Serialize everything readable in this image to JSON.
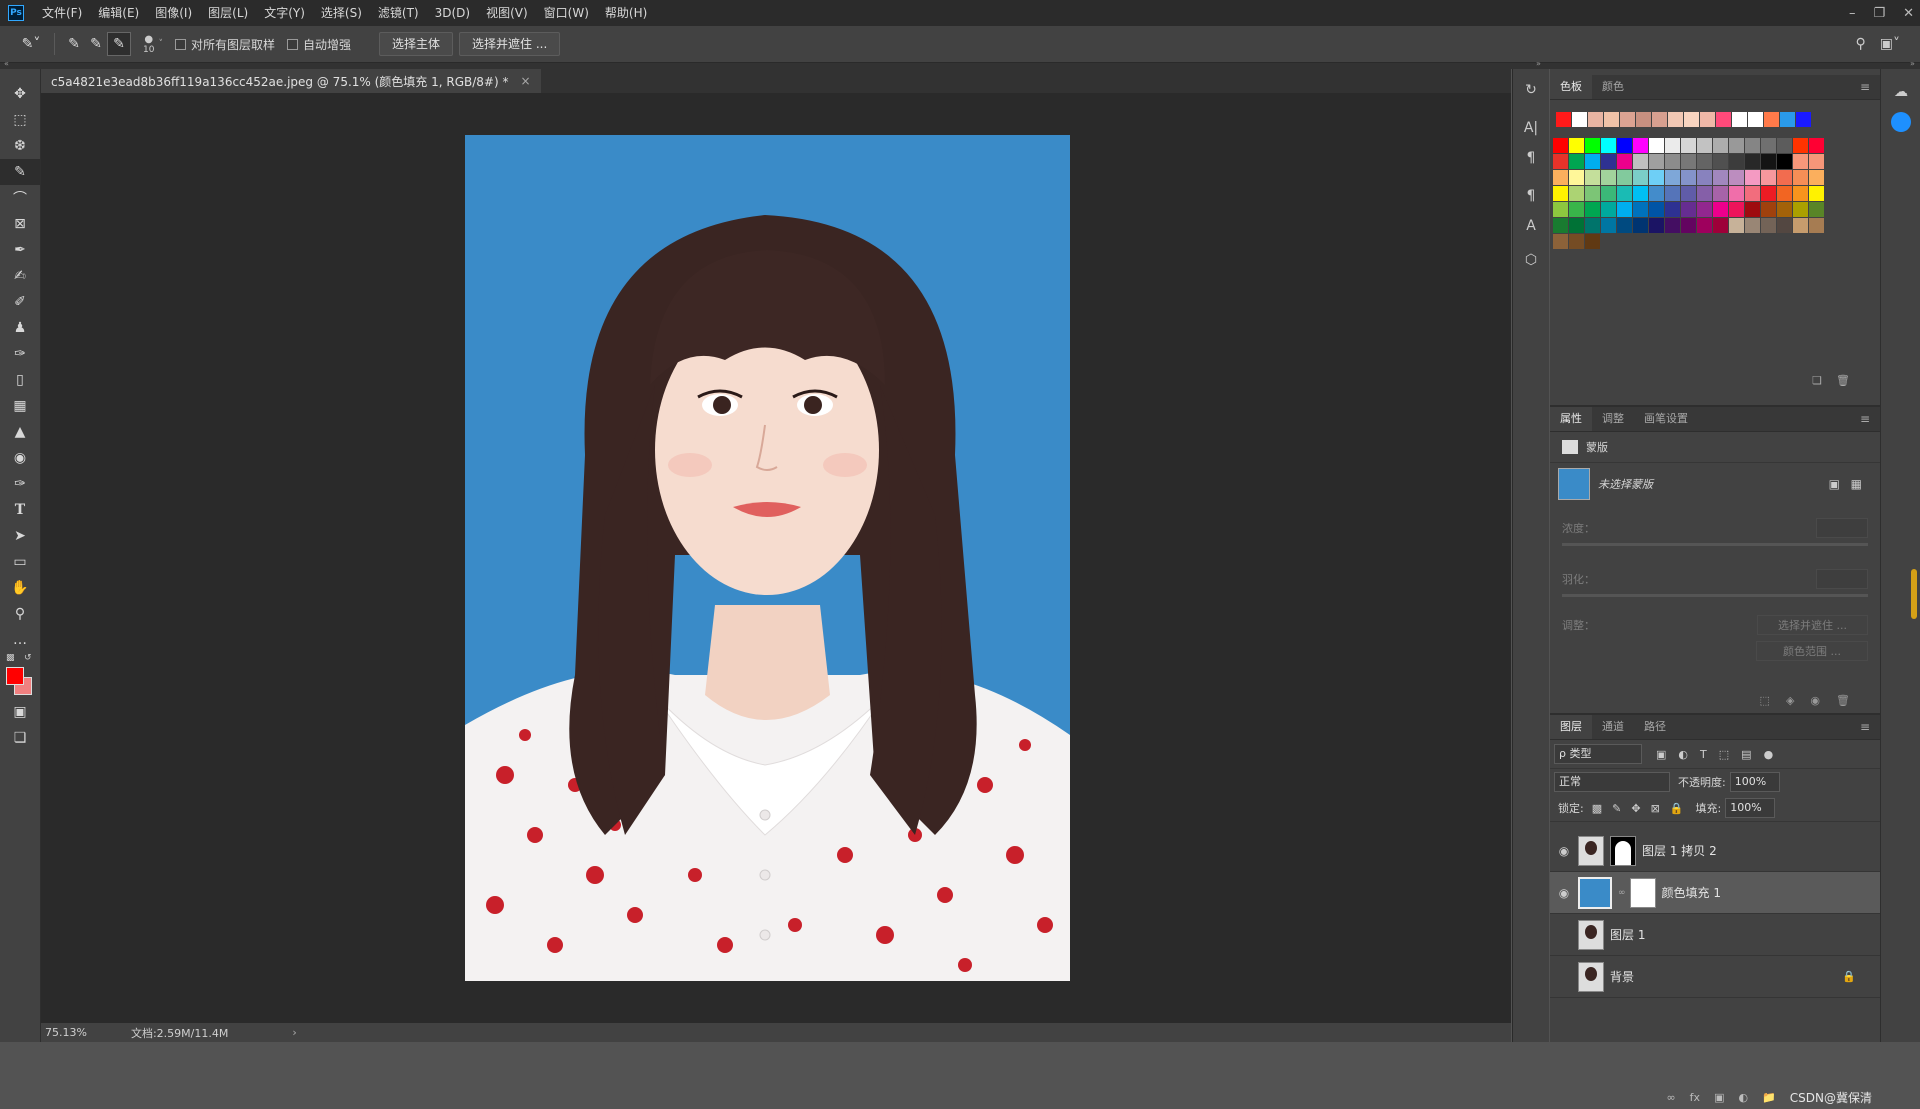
{
  "menu": {
    "logo": "Ps",
    "items": [
      "文件(F)",
      "编辑(E)",
      "图像(I)",
      "图层(L)",
      "文字(Y)",
      "选择(S)",
      "滤镜(T)",
      "3D(D)",
      "视图(V)",
      "窗口(W)",
      "帮助(H)"
    ]
  },
  "options": {
    "brush_size": "10",
    "sample_all_layers": "对所有图层取样",
    "auto_enhance": "自动增强",
    "select_subject": "选择主体",
    "select_and_mask": "选择并遮住 ..."
  },
  "document": {
    "tab_title": "c5a4821e3ead8b36ff119a136cc452ae.jpeg @ 75.1% (颜色填充 1, RGB/8#) *",
    "zoom": "75.13%",
    "doc_size": "文档:2.59M/11.4M"
  },
  "swatches_panel": {
    "tabs": [
      "色板",
      "颜色"
    ],
    "recent": [
      "#ff1a1a",
      "#ffffff",
      "#e8b4a2",
      "#f0c2a8",
      "#dca392",
      "#c89080",
      "#d8a090",
      "#f2c8b4",
      "#f8d4c0",
      "#f0b8a8",
      "#ff4a7a",
      "#ffffff",
      "#ffffff",
      "#ff7a4a",
      "#2a9aea",
      "#1a1aff"
    ],
    "grid": [
      [
        "#ff0000",
        "#ffff00",
        "#00ff00",
        "#00ffff",
        "#0000ff",
        "#ff00ff",
        "#ffffff",
        "#ebebeb",
        "#d6d6d6",
        "#c2c2c2",
        "#adadad",
        "#999999",
        "#858585",
        "#707070",
        "#5c5c5c",
        "#ff3300",
        "#ff0033"
      ],
      [
        "#e6332a",
        "#00a651",
        "#00aeef",
        "#2e3192",
        "#ec008c",
        "#c0c0c0",
        "#a0a0a0",
        "#8c8c8c",
        "#787878",
        "#646464",
        "#505050",
        "#3c3c3c",
        "#282828",
        "#141414",
        "#000000",
        "#f7977a",
        "#f69679"
      ],
      [
        "#fbaf5d",
        "#fff799",
        "#c4df9b",
        "#a2d39c",
        "#82ca9d",
        "#7bcdc8",
        "#6ecff6",
        "#7ea7d8",
        "#8493ca",
        "#8882be",
        "#a187be",
        "#bc8dbf",
        "#f49ac2",
        "#f6989d",
        "#f26c4f",
        "#f68e56",
        "#fbaf5d"
      ],
      [
        "#fff200",
        "#acd373",
        "#7cc576",
        "#3bb878",
        "#1abbb4",
        "#00bff3",
        "#438ccb",
        "#5574b9",
        "#605ca8",
        "#855fa8",
        "#a763a8",
        "#f06eaa",
        "#f26d7d",
        "#ed1c24",
        "#f26522",
        "#f7941d",
        "#fff200"
      ],
      [
        "#8dc73f",
        "#39b54a",
        "#00a651",
        "#00a99d",
        "#00aeef",
        "#0072bc",
        "#0054a6",
        "#2e3192",
        "#662d91",
        "#92278f",
        "#ec008c",
        "#ed145b",
        "#9e0b0f",
        "#a0410d",
        "#a36209",
        "#aba000",
        "#598527"
      ],
      [
        "#197b30",
        "#007236",
        "#00746b",
        "#0076a3",
        "#004a80",
        "#003471",
        "#1b1464",
        "#440e62",
        "#630460",
        "#9e005d",
        "#9e0039",
        "#c7b299",
        "#998675",
        "#736357",
        "#534741",
        "#c69c6d",
        "#a67c52"
      ],
      [
        "#8c6239",
        "#754c24",
        "#603913"
      ]
    ]
  },
  "properties_panel": {
    "tabs": [
      "属性",
      "调整",
      "画笔设置"
    ],
    "section": "蒙版",
    "mask_label": "未选择蒙版",
    "density": "浓度：",
    "feather": "羽化：",
    "adjust": "调整：",
    "select_mask_btn": "选择并遮住 ...",
    "color_range_btn": "颜色范围 ..."
  },
  "layers_panel": {
    "tabs": [
      "图层",
      "通道",
      "路径"
    ],
    "filter": "ρ 类型",
    "blend_mode": "正常",
    "opacity_label": "不透明度:",
    "opacity_value": "100%",
    "lock_label": "锁定:",
    "fill_label": "填充:",
    "fill_value": "100%",
    "layers": [
      {
        "name": "图层 1 拷贝 2",
        "visible": true
      },
      {
        "name": "颜色填充 1",
        "visible": true,
        "selected": true
      },
      {
        "name": "图层 1",
        "visible": false
      },
      {
        "name": "背景",
        "visible": false
      }
    ]
  },
  "watermark": "CSDN@冀保清",
  "colors": {
    "fill_blue": "#3a8bc8",
    "foreground": "#ff0000",
    "background": "#f08080"
  }
}
